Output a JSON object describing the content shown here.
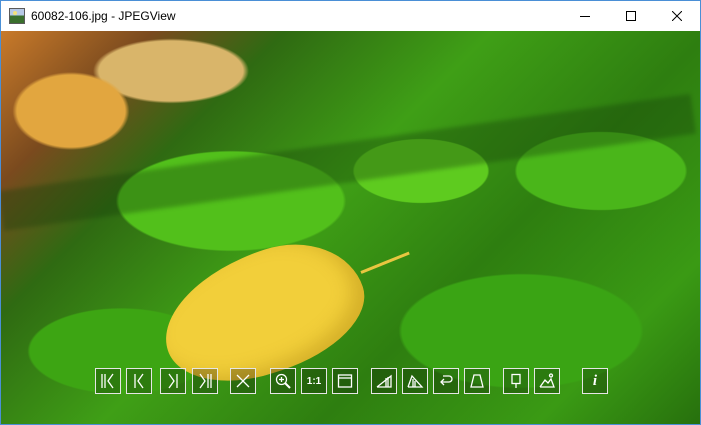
{
  "window": {
    "title": "60082-106.jpg - JPEGView"
  },
  "window_controls": {
    "minimize_icon": "minimize-icon",
    "maximize_icon": "maximize-icon",
    "close_icon": "close-icon"
  },
  "image": {
    "subject": "moss-with-yellow-leaf-photo"
  },
  "toolbar": {
    "zoom_1to1_label": "1:1",
    "info_label": "i",
    "buttons": [
      {
        "icon": "first-image-icon"
      },
      {
        "icon": "previous-image-icon"
      },
      {
        "icon": "next-image-icon"
      },
      {
        "icon": "last-image-icon"
      },
      {
        "icon": "delete-icon"
      },
      {
        "icon": "zoom-icon"
      },
      {
        "icon": "zoom-1to1-icon"
      },
      {
        "icon": "fit-to-window-icon"
      },
      {
        "icon": "rotate-left-icon"
      },
      {
        "icon": "rotate-right-icon"
      },
      {
        "icon": "rotate-arrow-icon"
      },
      {
        "icon": "perspective-icon"
      },
      {
        "icon": "keep-params-icon"
      },
      {
        "icon": "landscape-enhance-icon"
      },
      {
        "icon": "info-icon"
      }
    ]
  },
  "colors": {
    "window_border": "#4a8fd6",
    "toolbar_icon": "#ffffff"
  }
}
